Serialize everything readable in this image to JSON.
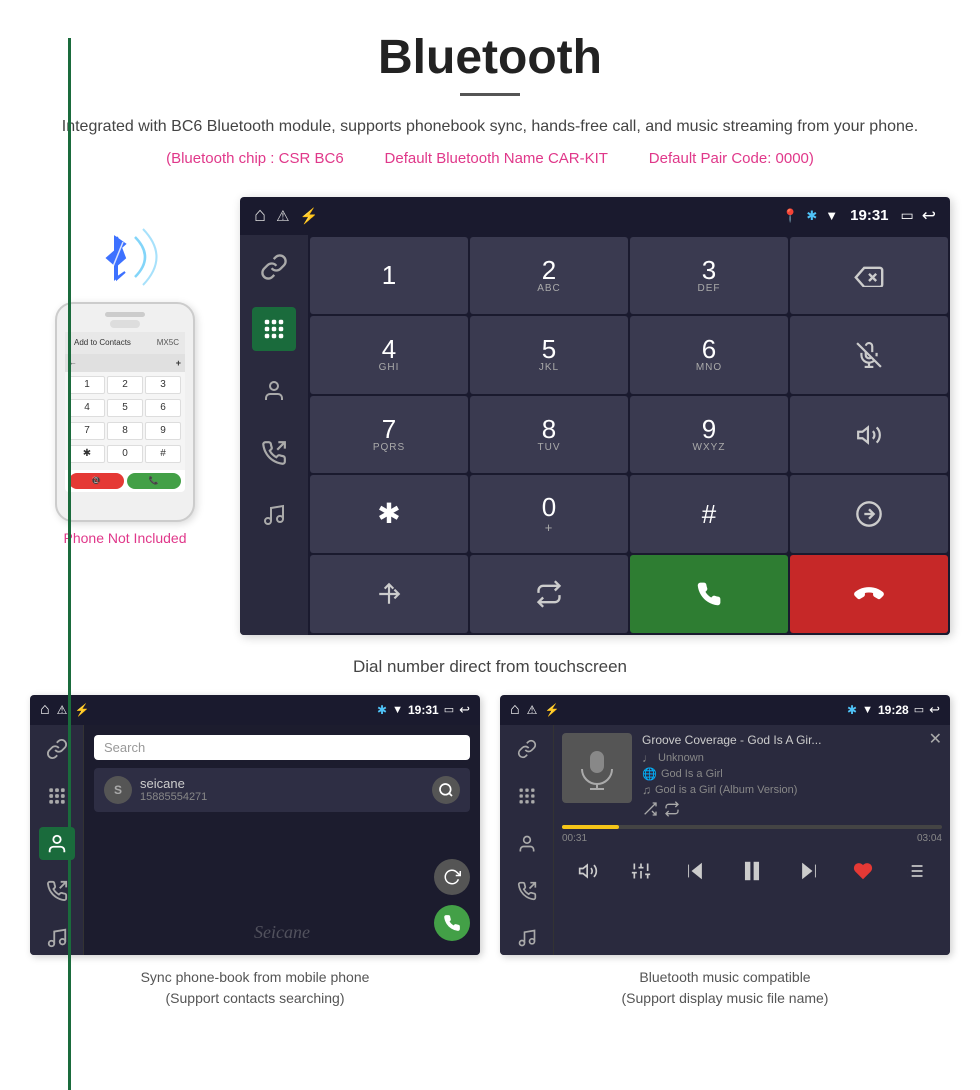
{
  "header": {
    "title": "Bluetooth",
    "description": "Integrated with BC6 Bluetooth module, supports phonebook sync, hands-free call, and music streaming from your phone.",
    "specs": {
      "chip": "(Bluetooth chip : CSR BC6",
      "name": "Default Bluetooth Name CAR-KIT",
      "code": "Default Pair Code: 0000)"
    }
  },
  "phone_label": "Phone Not Included",
  "dialpad_caption": "Dial number direct from touchscreen",
  "car_statusbar": {
    "left_icons": [
      "home",
      "warning",
      "usb"
    ],
    "time": "19:31",
    "right_icons": [
      "location",
      "bluetooth",
      "signal",
      "battery",
      "back"
    ]
  },
  "dialpad": {
    "buttons": [
      {
        "main": "1",
        "sub": ""
      },
      {
        "main": "2",
        "sub": "ABC"
      },
      {
        "main": "3",
        "sub": "DEF"
      },
      {
        "main": "⌫",
        "sub": ""
      },
      {
        "main": "4",
        "sub": "GHI"
      },
      {
        "main": "5",
        "sub": "JKL"
      },
      {
        "main": "6",
        "sub": "MNO"
      },
      {
        "main": "🎙",
        "sub": ""
      },
      {
        "main": "7",
        "sub": "PQRS"
      },
      {
        "main": "8",
        "sub": "TUV"
      },
      {
        "main": "9",
        "sub": "WXYZ"
      },
      {
        "main": "🔊",
        "sub": ""
      },
      {
        "main": "✱",
        "sub": ""
      },
      {
        "main": "0",
        "sub": "+"
      },
      {
        "main": "#",
        "sub": ""
      },
      {
        "main": "⇅",
        "sub": ""
      },
      {
        "main": "↑",
        "sub": ""
      },
      {
        "main": "⇄",
        "sub": ""
      },
      {
        "main": "📞",
        "sub": ""
      },
      {
        "main": "📵",
        "sub": ""
      }
    ]
  },
  "phonebook": {
    "search_placeholder": "Search",
    "contact": {
      "initial": "S",
      "name": "seicane",
      "phone": "15885554271"
    },
    "caption": "Sync phone-book from mobile phone",
    "sub_caption": "(Support contacts searching)"
  },
  "music": {
    "title": "Groove Coverage - God Is A Gir...",
    "details": [
      {
        "icon": "♩",
        "text": "Unknown"
      },
      {
        "icon": "🌐",
        "text": "God Is a Girl"
      },
      {
        "icon": "♫",
        "text": "God is a Girl (Album Version)"
      }
    ],
    "time_current": "00:31",
    "time_total": "03:04",
    "progress_percent": 15,
    "caption": "Bluetooth music compatible",
    "sub_caption": "(Support display music file name)"
  }
}
